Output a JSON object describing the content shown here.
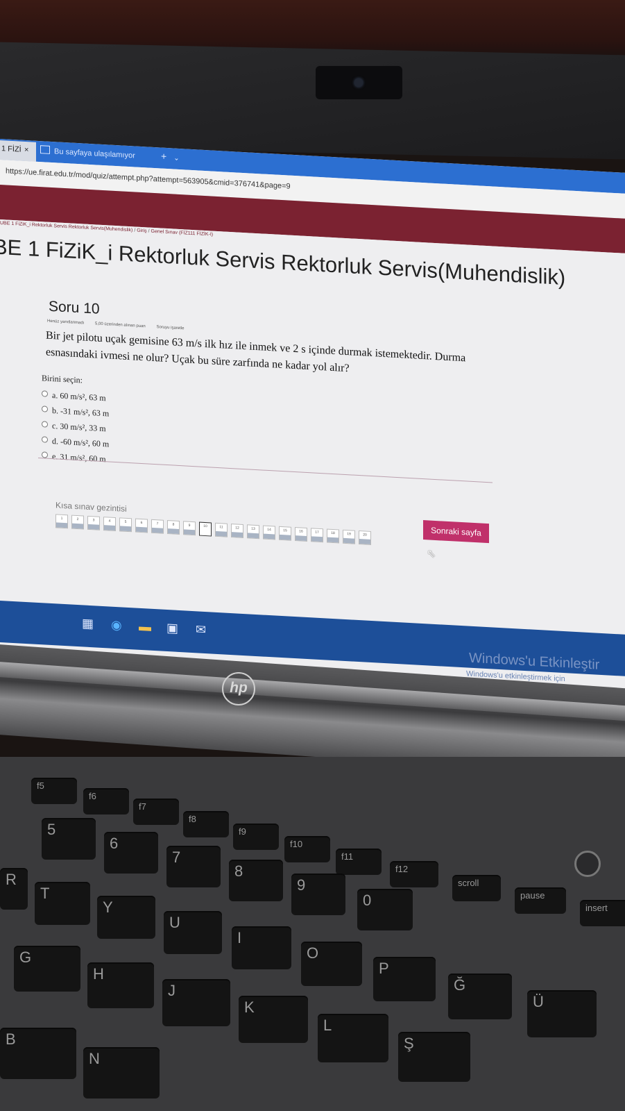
{
  "browser": {
    "active_tab": "1 FİZİ",
    "active_tab_close": "×",
    "second_tab": "Bu sayfaya ulaşılamıyor",
    "new_tab": "+",
    "tab_list": "⌄",
    "url": "https://ue.firat.edu.tr/mod/quiz/attempt.php?attempt=563905&cmid=376741&page=9"
  },
  "breadcrumb": {
    "course": "UBE 1 FiZiK_i Rektorluk Servis Rektorluk Servis(Muhendislik)",
    "sep1": "/",
    "section": "Giriş",
    "sep2": "/",
    "quiz": "Genel Sınav (FİZ111 FİZİK-I)"
  },
  "course_title": "BE 1 FiZiK_i Rektorluk Servis Rektorluk Servis(Muhendislik)",
  "question": {
    "heading": "Soru 10",
    "status": "Henüz yanıtlanmadı",
    "points": "5,00 üzerinden alınan puan",
    "flag": "Soruyu işaretle",
    "text": "Bir jet pilotu uçak gemisine 63 m/s ilk hız ile inmek ve 2 s içinde durmak istemektedir. Durma esnasındaki ivmesi ne olur? Uçak bu süre zarfında ne kadar yol alır?",
    "prompt": "Birini seçin:",
    "options": [
      "a. 60 m/s², 63 m",
      "b. -31 m/s², 63 m",
      "c. 30 m/s², 33 m",
      "d. -60 m/s², 60 m",
      "e. 31 m/s², 60 m"
    ]
  },
  "quiz_nav": {
    "title": "Kısa sınav gezintisi",
    "pages": [
      "1",
      "2",
      "3",
      "4",
      "5",
      "6",
      "7",
      "8",
      "9",
      "10",
      "11",
      "12",
      "13",
      "14",
      "15",
      "16",
      "17",
      "18",
      "19",
      "20"
    ],
    "current": "10",
    "next_button": "Sonraki sayfa"
  },
  "windows": {
    "activate_title": "Windows'u Etkinleştir",
    "activate_sub": "Windows'u etkinleştirmek için",
    "tray": "^ 🔋 🖧"
  },
  "laptop": {
    "logo": "hp"
  },
  "keys": {
    "f5": "f5",
    "f6": "f6",
    "f7": "f7",
    "f8": "f8",
    "f9": "f9",
    "f10": "f10",
    "f11": "f11",
    "f12": "f12",
    "scroll": "scroll",
    "pause": "pause",
    "insert": "insert",
    "n5": "5",
    "n6": "6",
    "n7": "7",
    "n8": "8",
    "n9": "9",
    "n0": "0",
    "r": "R",
    "t": "T",
    "y": "Y",
    "u": "U",
    "i": "I",
    "o": "O",
    "p": "P",
    "g_breve": "Ğ",
    "u_uml": "Ü",
    "g": "G",
    "h": "H",
    "j": "J",
    "k": "K",
    "l": "L",
    "s_ced": "Ş",
    "b": "B",
    "n": "N"
  }
}
